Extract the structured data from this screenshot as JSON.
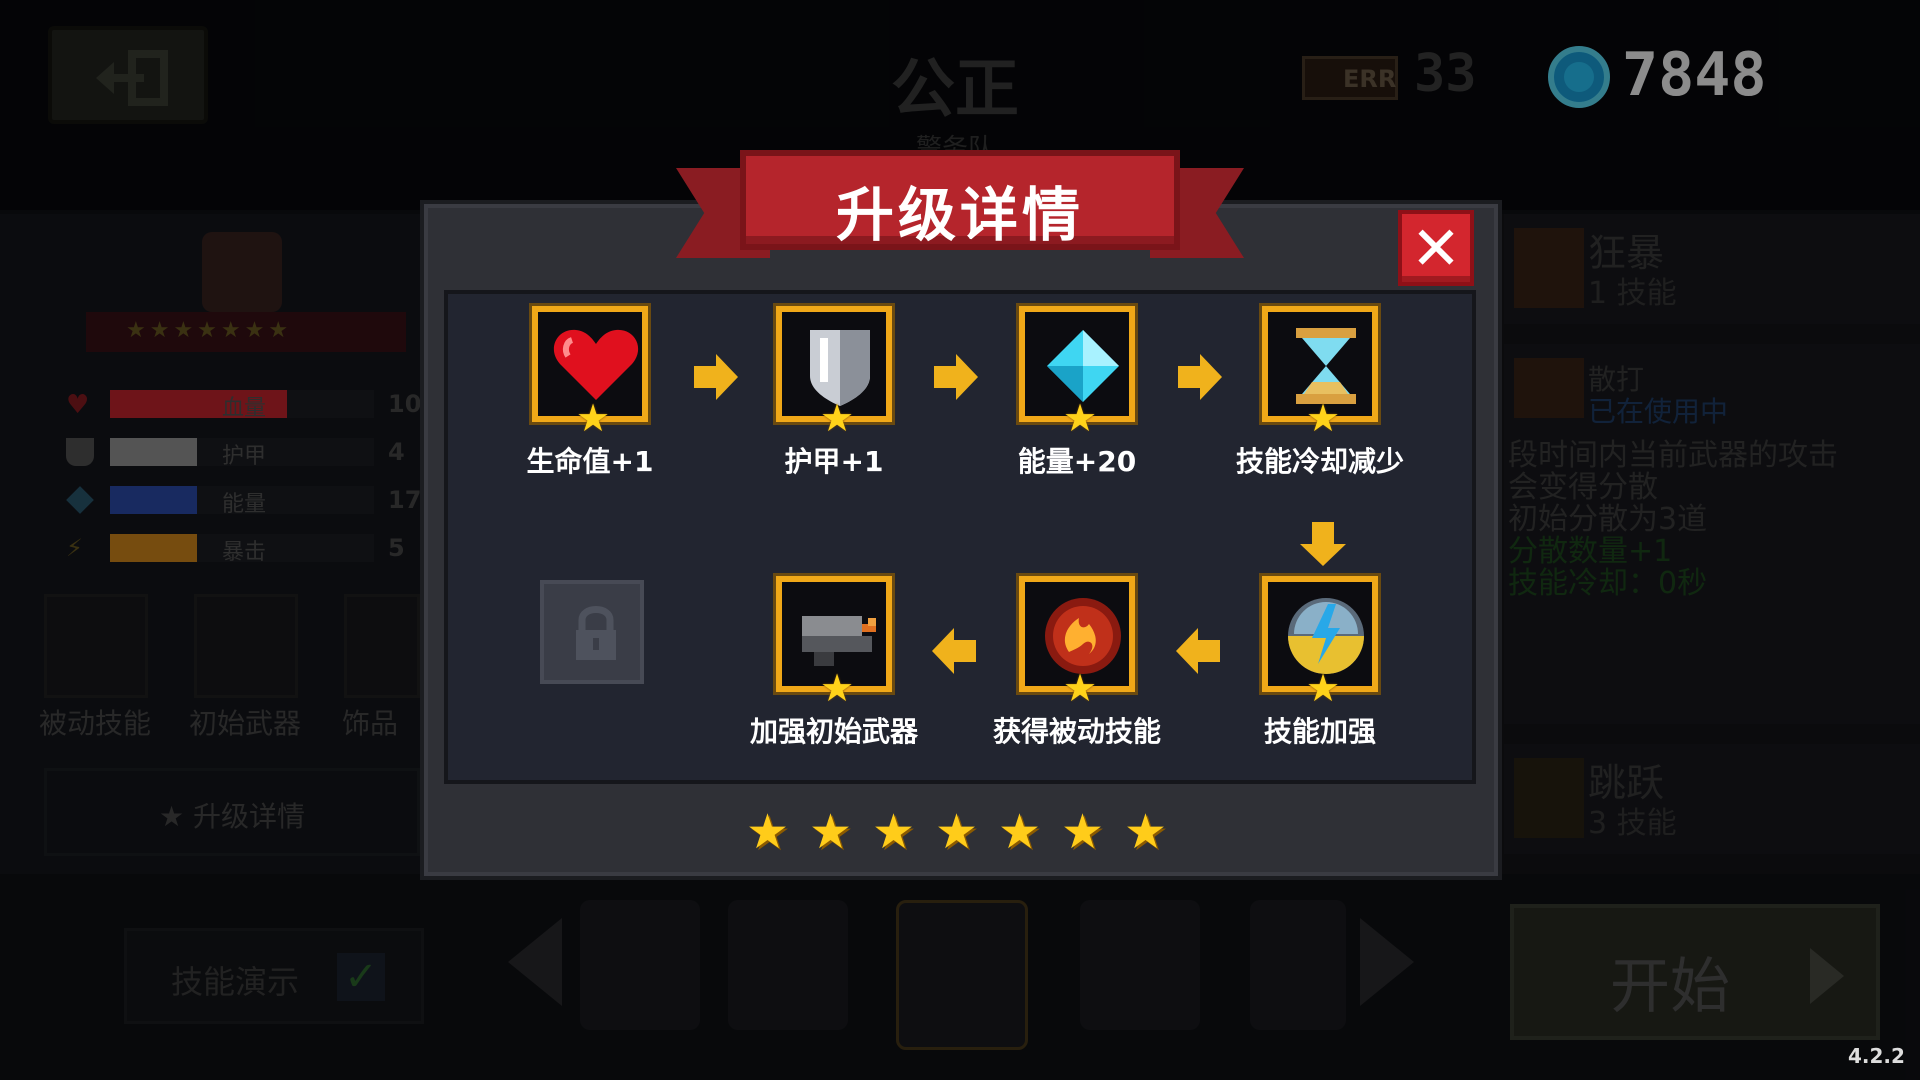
{
  "header": {
    "hero_name": "公正",
    "hero_subtitle": "警务队",
    "gem_label": "ERR",
    "gem_count": "33",
    "coin_count": "7848"
  },
  "left_panel": {
    "stats": [
      {
        "label": "血量",
        "value": "10",
        "color": "#c8262e",
        "fill": 0.67
      },
      {
        "label": "护甲",
        "value": "4",
        "color": "#9a9a9a",
        "fill": 0.33
      },
      {
        "label": "能量",
        "value": "17",
        "color": "#2c4db0",
        "fill": 0.33
      },
      {
        "label": "暴击",
        "value": "5",
        "color": "#d88a1c",
        "fill": 0.33
      }
    ],
    "slots": [
      "被动技能",
      "初始武器",
      "饰品"
    ],
    "upgrade_button": "★ 升级详情"
  },
  "right_panel": {
    "skill_1": {
      "title": "狂暴",
      "subtitle": "1 技能"
    },
    "skill_2": {
      "title": "散打",
      "status": "已在使用中"
    },
    "description": [
      "段时间内当前武器的攻击",
      "会变得分散",
      "初始分散为3道",
      "分散数量+1",
      "技能冷却：0秒"
    ],
    "skill_3": {
      "title": "跳跃",
      "subtitle": "3 技能"
    }
  },
  "footer": {
    "demo_label": "技能演示",
    "start_label": "开始",
    "version": "4.2.2"
  },
  "modal": {
    "title": "升级详情",
    "close_symbol": "✕",
    "nodes": [
      {
        "label": "生命值+1",
        "icon": "heart-icon"
      },
      {
        "label": "护甲+1",
        "icon": "shield-icon"
      },
      {
        "label": "能量+20",
        "icon": "crystal-icon"
      },
      {
        "label": "技能冷却减少",
        "icon": "hourglass-icon"
      },
      {
        "label": "技能加强",
        "icon": "skill-orb-icon"
      },
      {
        "label": "获得被动技能",
        "icon": "fire-orb-icon"
      },
      {
        "label": "加强初始武器",
        "icon": "gun-icon"
      }
    ],
    "node_star": "★",
    "rank_stars": [
      "★",
      "★",
      "★",
      "★",
      "★",
      "★",
      "★"
    ],
    "colors": {
      "accent": "#f0a818",
      "ribbon": "#b5252c",
      "close": "#d3262e"
    }
  }
}
